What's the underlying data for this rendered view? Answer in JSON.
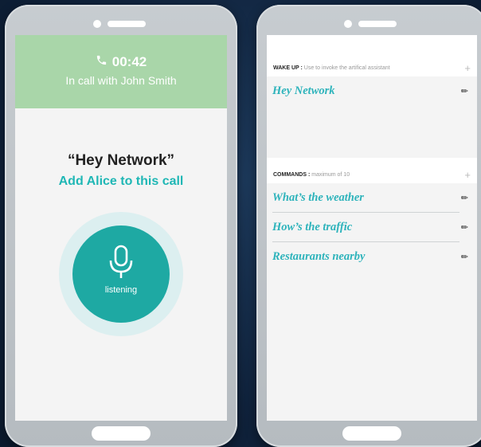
{
  "left_phone": {
    "call_timer": "00:42",
    "call_status": "In call with John Smith",
    "wake_phrase": "“Hey Network”",
    "action_text": "Add Alice to this call",
    "mic_state": "listening",
    "icons": [
      "phone-icon",
      "microphone-icon"
    ]
  },
  "right_phone": {
    "wake_section": {
      "title": "WAKE UP :",
      "description": "Use to invoke the artifical assistant",
      "items": [
        "Hey Network"
      ]
    },
    "commands_section": {
      "title": "COMMANDS :",
      "description": "maximum of 10",
      "items": [
        "What’s the weather",
        "How’s the traffic",
        "Restaurants nearby"
      ]
    },
    "icons": [
      "plus-icon",
      "pencil-icon"
    ]
  },
  "colors": {
    "accent_teal": "#1ea9a3",
    "header_green": "#a9d6a9",
    "command_text": "#2db3bb"
  }
}
